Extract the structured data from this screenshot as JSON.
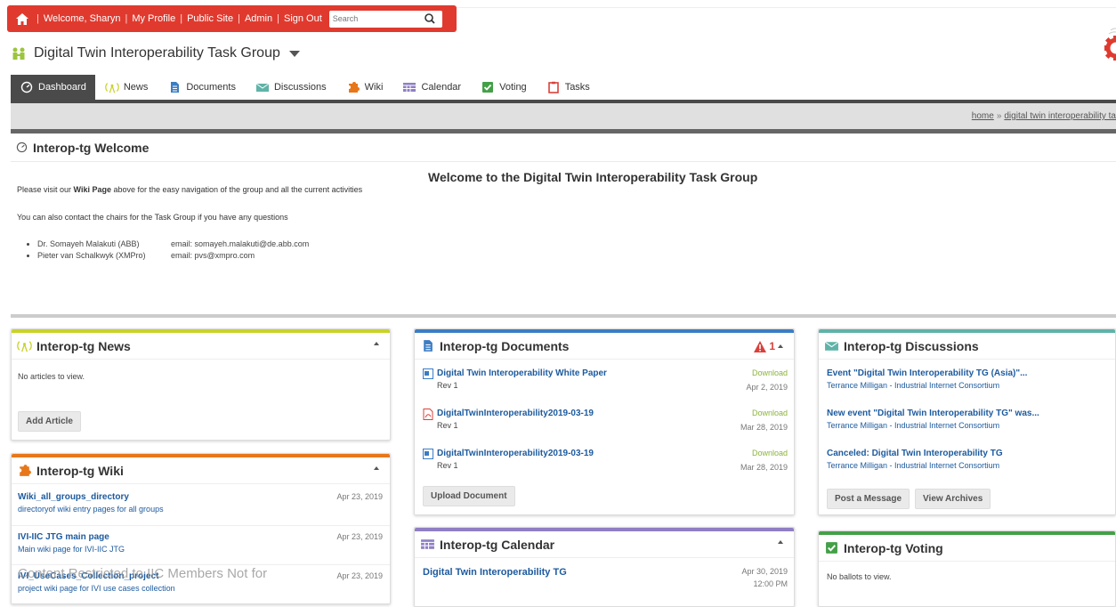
{
  "topbar": {
    "links": [
      "Welcome, Sharyn",
      "My Profile",
      "Public Site",
      "Admin",
      "Sign Out"
    ],
    "search_placeholder": "Search"
  },
  "group": {
    "title": "Digital Twin Interoperability Task Group"
  },
  "nav": {
    "tabs": [
      {
        "label": "Dashboard",
        "icon": "dashboard-icon",
        "color": "#ffffff",
        "active": true
      },
      {
        "label": "News",
        "icon": "news-icon",
        "color": "#9bc53d"
      },
      {
        "label": "Documents",
        "icon": "documents-icon",
        "color": "#3b7dc4"
      },
      {
        "label": "Discussions",
        "icon": "discussions-icon",
        "color": "#5fb3a8"
      },
      {
        "label": "Wiki",
        "icon": "wiki-icon",
        "color": "#e8771a"
      },
      {
        "label": "Calendar",
        "icon": "calendar-icon",
        "color": "#7a6fbf"
      },
      {
        "label": "Voting",
        "icon": "voting-icon",
        "color": "#43a047"
      },
      {
        "label": "Tasks",
        "icon": "tasks-icon",
        "color": "#d9413b"
      }
    ]
  },
  "breadcrumb": {
    "home": "home",
    "sep": "»",
    "current": "digital twin interoperability ta"
  },
  "welcome": {
    "title": "Interop-tg Welcome",
    "heading": "Welcome to the Digital Twin Interoperability Task Group",
    "line1_pre": "Please visit our ",
    "line1_bold": "Wiki Page",
    "line1_post": " above for the easy navigation of the group and all the current activities",
    "line2": "You can also contact the chairs for the Task Group if you have any questions",
    "contacts": [
      {
        "name": "Dr. Somayeh Malakuti (ABB)",
        "email": "email: somayeh.malakuti@de.abb.com"
      },
      {
        "name": "Pieter van Schalkwyk (XMPro)",
        "email": "email: pvs@xmpro.com"
      }
    ]
  },
  "news": {
    "title": "Interop-tg News",
    "empty": "No articles to view.",
    "button": "Add Article",
    "accent": "#c9d22a"
  },
  "wiki": {
    "title": "Interop-tg Wiki",
    "accent": "#e8771a",
    "items": [
      {
        "title": "Wiki_all_groups_directory",
        "desc": "directoryof wiki entry pages for all groups",
        "date": "Apr 23, 2019"
      },
      {
        "title": "IVI-IIC JTG main page",
        "desc": "Main wiki page for IVI-IIC JTG",
        "date": "Apr 23, 2019"
      },
      {
        "title": "IVI_UseCases_Collection_project",
        "desc": "project wiki page for IVI use cases collection",
        "date": "Apr 23, 2019"
      }
    ]
  },
  "documents": {
    "title": "Interop-tg Documents",
    "accent": "#3b7dc4",
    "alert_count": "1",
    "items": [
      {
        "title": "Digital Twin Interoperability White Paper",
        "rev": "Rev 1",
        "action": "Download",
        "date": "Apr 2, 2019",
        "icon": "word-doc-icon"
      },
      {
        "title": "DigitalTwinInteroperability2019-03-19",
        "rev": "Rev 1",
        "action": "Download",
        "date": "Mar 28, 2019",
        "icon": "pdf-doc-icon"
      },
      {
        "title": "DigitalTwinInteroperability2019-03-19",
        "rev": "Rev 1",
        "action": "Download",
        "date": "Mar 28, 2019",
        "icon": "word-doc-icon"
      }
    ],
    "button": "Upload Document"
  },
  "calendar": {
    "title": "Interop-tg Calendar",
    "accent": "#8f7fc4",
    "items": [
      {
        "title": "Digital Twin Interoperability TG",
        "date": "Apr 30, 2019",
        "time": "12:00 PM"
      }
    ]
  },
  "discussions": {
    "title": "Interop-tg Discussions",
    "accent": "#5fb3a8",
    "items": [
      {
        "title": "Event \"Digital Twin Interoperability TG (Asia)\"...",
        "author": "Terrance Milligan - Industrial Internet Consortium"
      },
      {
        "title": "New event \"Digital Twin Interoperability TG\" was...",
        "author": "Terrance Milligan - Industrial Internet Consortium"
      },
      {
        "title": "Canceled: Digital Twin Interoperability TG",
        "author": "Terrance Milligan - Industrial Internet Consortium"
      }
    ],
    "buttons": [
      "Post a Message",
      "View Archives"
    ]
  },
  "voting": {
    "title": "Interop-tg Voting",
    "accent": "#43a047",
    "empty": "No ballots to view."
  },
  "overlay": {
    "text": "Content Restricted to IIC Members Not for"
  }
}
